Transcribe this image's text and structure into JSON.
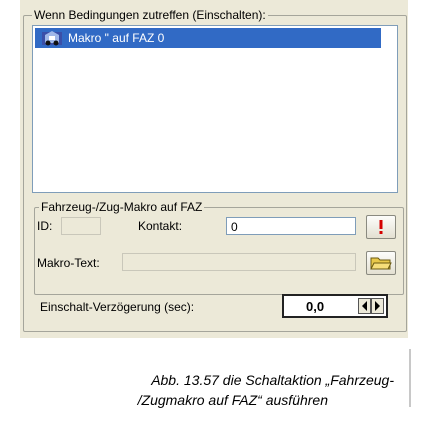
{
  "dialog": {
    "conditions_group_label": "Wenn Bedingungen zutreffen (Einschalten):",
    "conditions_list": [
      {
        "label": "Makro  \" auf FAZ 0",
        "icon": "macro-train-icon",
        "selected": true
      }
    ],
    "macro_group_label": "Fahrzeug-/Zug-Makro auf FAZ",
    "id_label": "ID:",
    "id_value": "",
    "contact_label": "Kontakt:",
    "contact_value": "0",
    "alert_button_icon": "exclamation-icon",
    "macro_text_label": "Makro-Text:",
    "macro_text_value": "",
    "folder_button_icon": "folder-icon",
    "delay_label": "Einschalt-Verzögerung (sec):",
    "delay_value": "0,0"
  },
  "caption": {
    "line1": "Abb. 13.57 die Schaltaktion „Fahrzeug-",
    "line2": "/Zugmakro auf FAZ“ ausführen"
  },
  "colors": {
    "dialog_bg": "#ece9d8",
    "selection_bg": "#316ac5",
    "alert_red": "#d40000"
  }
}
